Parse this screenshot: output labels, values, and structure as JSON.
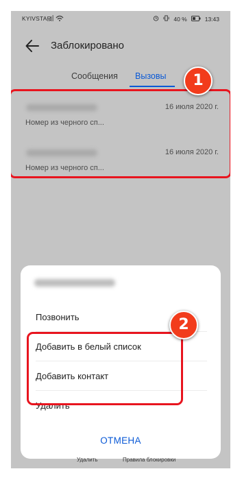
{
  "status_bar": {
    "carrier": "KYIVSTAR",
    "battery": "40 %",
    "time": "13:43"
  },
  "header": {
    "title": "Заблокировано"
  },
  "tabs": [
    {
      "label": "Сообщения",
      "active": false
    },
    {
      "label": "Вызовы",
      "active": true
    }
  ],
  "calls": [
    {
      "date": "16 июля 2020 г.",
      "subtitle": "Номер из черного сп..."
    },
    {
      "date": "16 июля 2020 г.",
      "subtitle": "Номер из черного сп..."
    }
  ],
  "callouts": [
    "1",
    "2"
  ],
  "menu": {
    "items": [
      {
        "label": "Позвонить"
      },
      {
        "label": "Добавить в белый список"
      },
      {
        "label": "Добавить контакт"
      },
      {
        "label": "Удалить"
      }
    ],
    "cancel_label": "ОТМЕНА"
  },
  "bottom_bar": {
    "delete_label": "Удалить",
    "rules_label": "Правила блокировки"
  },
  "colors": {
    "accent": "#0a59d6",
    "highlight": "#e8141e",
    "callout": "#f23c1c",
    "overlay": "#c4c4c4"
  }
}
